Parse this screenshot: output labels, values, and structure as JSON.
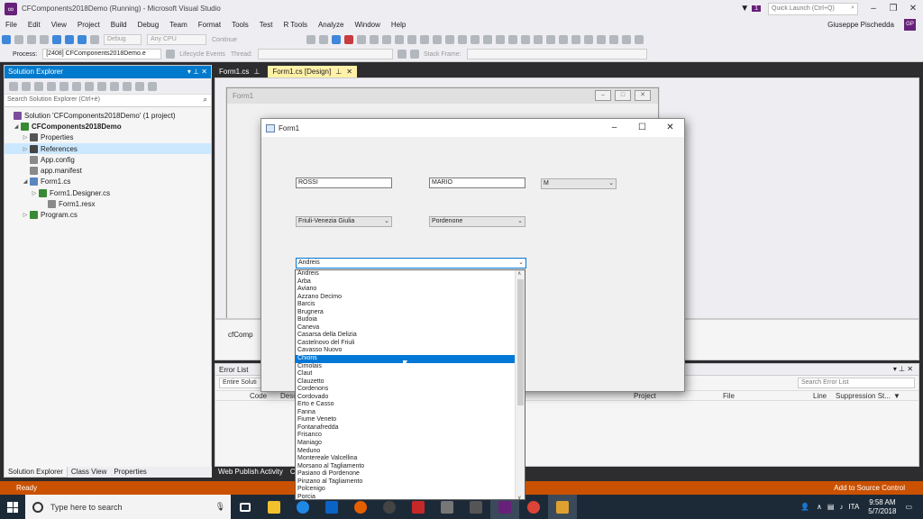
{
  "window": {
    "title": "CFComponents2018Demo (Running) - Microsoft Visual Studio",
    "notif_count": "1",
    "quick_launch": "Quick Launch (Ctrl+Q)"
  },
  "menu": [
    "File",
    "Edit",
    "View",
    "Project",
    "Build",
    "Debug",
    "Team",
    "Format",
    "Tools",
    "Test",
    "R Tools",
    "Analyze",
    "Window",
    "Help"
  ],
  "user": {
    "name": "Giuseppe Pischedda",
    "initials": "GP"
  },
  "toolbar": {
    "config": "Debug",
    "platform": "Any CPU",
    "continue": "Continue",
    "process_label": "Process:",
    "process": "[2408] CFComponents2018Demo.e",
    "lifecycle": "Lifecycle Events",
    "thread": "Thread:",
    "stack_frame": "Stack Frame:"
  },
  "solution_explorer": {
    "title": "Solution Explorer",
    "search_placeholder": "Search Solution Explorer (Ctrl+è)",
    "items": [
      {
        "label": "Solution 'CFComponents2018Demo' (1 project)"
      },
      {
        "label": "CFComponents2018Demo"
      },
      {
        "label": "Properties"
      },
      {
        "label": "References"
      },
      {
        "label": "App.config"
      },
      {
        "label": "app.manifest"
      },
      {
        "label": "Form1.cs"
      },
      {
        "label": "Form1.Designer.cs"
      },
      {
        "label": "Form1.resx"
      },
      {
        "label": "Program.cs"
      }
    ],
    "tabs": [
      "Solution Explorer",
      "Class View",
      "Properties"
    ]
  },
  "doc_tabs": [
    {
      "label": "Form1.cs"
    },
    {
      "label": "Form1.cs [Design]"
    }
  ],
  "designer": {
    "form_title": "Form1",
    "tray_label": "cfComp"
  },
  "error_list": {
    "title": "Error List",
    "scope": "Entire Soluti",
    "search_placeholder": "Search Error List",
    "columns": [
      "Code",
      "Desc",
      "Project",
      "File",
      "Line",
      "Suppression St..."
    ]
  },
  "bottom_tabs": [
    "Web Publish Activity",
    "C"
  ],
  "status": {
    "left": "Ready",
    "right": "Add to Source Control"
  },
  "form": {
    "title": "Form1",
    "surname": "ROSSI",
    "name": "MARIO",
    "gender": "M",
    "region": "Friuli-Venezia Giulia",
    "province": "Pordenone",
    "town": "Andreis",
    "town_options": [
      "Andreis",
      "Arba",
      "Aviano",
      "Azzano Decimo",
      "Barcis",
      "Brugnera",
      "Budoia",
      "Caneva",
      "Casarsa della Delizia",
      "Castelnovo del Friuli",
      "Cavasso Nuovo",
      "Chions",
      "Cimolais",
      "Claut",
      "Clauzetto",
      "Cordenons",
      "Cordovado",
      "Erto e Casso",
      "Fanna",
      "Fiume Veneto",
      "Fontanafredda",
      "Frisanco",
      "Maniago",
      "Meduno",
      "Montereale Valcellina",
      "Morsano al Tagliamento",
      "Pasiano di Pordenone",
      "Pinzano al Tagliamento",
      "Polcenigo",
      "Porcia"
    ],
    "selected_option": "Chions"
  },
  "taskbar": {
    "search_placeholder": "Type here to search",
    "lang": "ITA",
    "time": "9:58 AM",
    "date": "5/7/2018"
  }
}
